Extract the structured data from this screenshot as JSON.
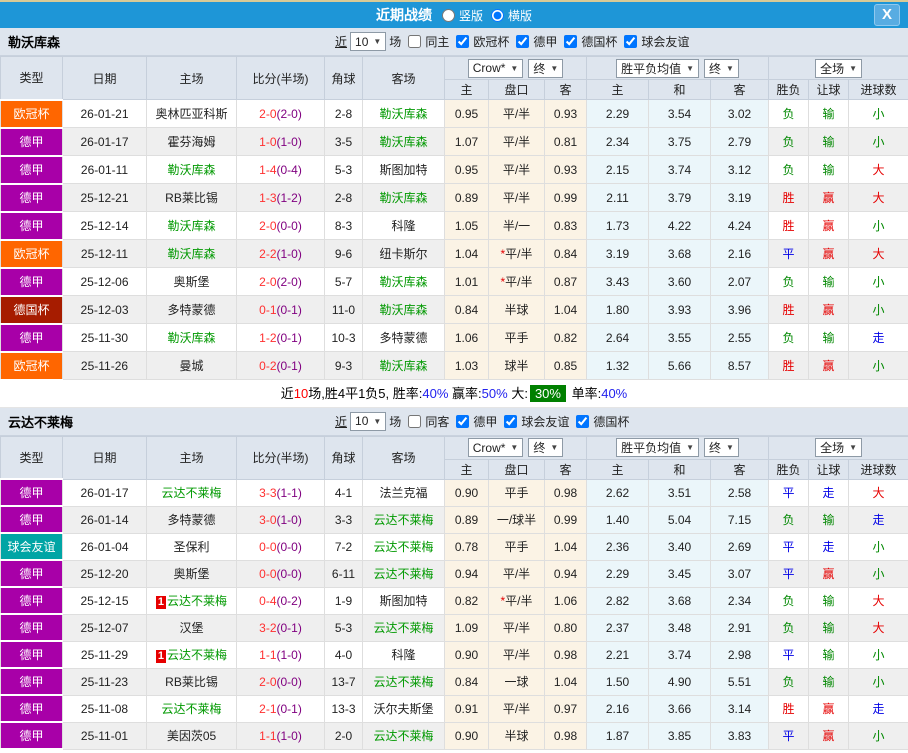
{
  "titlebar": {
    "title": "近期战绩",
    "vertical_label": "竖版",
    "horizontal_label": "横版",
    "horizontal_selected": true,
    "close_label": "X"
  },
  "headers": {
    "type": "类型",
    "date": "日期",
    "home": "主场",
    "score": "比分(半场)",
    "corner": "角球",
    "away": "客场",
    "crow": "Crow*",
    "final1": "终",
    "avg": "胜平负均值",
    "final2": "终",
    "full": "全场",
    "h1": "主",
    "handicap": "盘口",
    "a1": "客",
    "h2": "主",
    "draw": "和",
    "a2": "客",
    "wl": "胜负",
    "let_goal": "让球",
    "goals": "进球数"
  },
  "type_colors": {
    "欧冠杯": "#FF6600",
    "德甲": "#A800A8",
    "德国杯": "#A61C00",
    "球会友谊": "#00A5A5"
  },
  "result_colors": {
    "r": "#E60000",
    "g": "#008800",
    "b": "#0000E6"
  },
  "sections": [
    {
      "team": "勒沃库森",
      "filter": {
        "near_label": "近",
        "count": "10",
        "matches_label": "场",
        "same_label": "同主",
        "same_checked": false,
        "leagues": [
          {
            "label": "欧冠杯",
            "checked": true
          },
          {
            "label": "德甲",
            "checked": true
          },
          {
            "label": "德国杯",
            "checked": true
          },
          {
            "label": "球会友谊",
            "checked": true
          }
        ]
      },
      "rows": [
        {
          "type": "欧冠杯",
          "date": "26-01-21",
          "home": "奥林匹亚科斯",
          "home_hl": false,
          "badge": "",
          "score": "2-0",
          "half": "(2-0)",
          "corner": "2-8",
          "away": "勒沃库森",
          "away_hl": true,
          "o": [
            "0.95",
            "平/半",
            "0.93"
          ],
          "avg": [
            "2.29",
            "3.54",
            "3.02"
          ],
          "res": [
            [
              "负",
              "g"
            ],
            [
              "输",
              "g"
            ],
            [
              "小",
              "g"
            ]
          ]
        },
        {
          "type": "德甲",
          "date": "26-01-17",
          "home": "霍芬海姆",
          "home_hl": false,
          "badge": "",
          "score": "1-0",
          "half": "(1-0)",
          "corner": "3-5",
          "away": "勒沃库森",
          "away_hl": true,
          "o": [
            "1.07",
            "平/半",
            "0.81"
          ],
          "avg": [
            "2.34",
            "3.75",
            "2.79"
          ],
          "res": [
            [
              "负",
              "g"
            ],
            [
              "输",
              "g"
            ],
            [
              "小",
              "g"
            ]
          ]
        },
        {
          "type": "德甲",
          "date": "26-01-11",
          "home": "勒沃库森",
          "home_hl": true,
          "badge": "",
          "score": "1-4",
          "half": "(0-4)",
          "corner": "5-3",
          "away": "斯图加特",
          "away_hl": false,
          "o": [
            "0.95",
            "平/半",
            "0.93"
          ],
          "avg": [
            "2.15",
            "3.74",
            "3.12"
          ],
          "res": [
            [
              "负",
              "g"
            ],
            [
              "输",
              "g"
            ],
            [
              "大",
              "r"
            ]
          ]
        },
        {
          "type": "德甲",
          "date": "25-12-21",
          "home": "RB莱比锡",
          "home_hl": false,
          "badge": "",
          "score": "1-3",
          "half": "(1-2)",
          "corner": "2-8",
          "away": "勒沃库森",
          "away_hl": true,
          "o": [
            "0.89",
            "平/半",
            "0.99"
          ],
          "avg": [
            "2.11",
            "3.79",
            "3.19"
          ],
          "res": [
            [
              "胜",
              "r"
            ],
            [
              "赢",
              "r"
            ],
            [
              "大",
              "r"
            ]
          ]
        },
        {
          "type": "德甲",
          "date": "25-12-14",
          "home": "勒沃库森",
          "home_hl": true,
          "badge": "",
          "score": "2-0",
          "half": "(0-0)",
          "corner": "8-3",
          "away": "科隆",
          "away_hl": false,
          "o": [
            "1.05",
            "半/一",
            "0.83"
          ],
          "avg": [
            "1.73",
            "4.22",
            "4.24"
          ],
          "res": [
            [
              "胜",
              "r"
            ],
            [
              "赢",
              "r"
            ],
            [
              "小",
              "g"
            ]
          ]
        },
        {
          "type": "欧冠杯",
          "date": "25-12-11",
          "home": "勒沃库森",
          "home_hl": true,
          "badge": "",
          "score": "2-2",
          "half": "(1-0)",
          "corner": "9-6",
          "away": "纽卡斯尔",
          "away_hl": false,
          "o": [
            "1.04",
            "*平/半",
            "0.84"
          ],
          "avg": [
            "3.19",
            "3.68",
            "2.16"
          ],
          "res": [
            [
              "平",
              "b"
            ],
            [
              "赢",
              "r"
            ],
            [
              "大",
              "r"
            ]
          ]
        },
        {
          "type": "德甲",
          "date": "25-12-06",
          "home": "奥斯堡",
          "home_hl": false,
          "badge": "",
          "score": "2-0",
          "half": "(2-0)",
          "corner": "5-7",
          "away": "勒沃库森",
          "away_hl": true,
          "o": [
            "1.01",
            "*平/半",
            "0.87"
          ],
          "avg": [
            "3.43",
            "3.60",
            "2.07"
          ],
          "res": [
            [
              "负",
              "g"
            ],
            [
              "输",
              "g"
            ],
            [
              "小",
              "g"
            ]
          ]
        },
        {
          "type": "德国杯",
          "date": "25-12-03",
          "home": "多特蒙德",
          "home_hl": false,
          "badge": "",
          "score": "0-1",
          "half": "(0-1)",
          "corner": "11-0",
          "away": "勒沃库森",
          "away_hl": true,
          "o": [
            "0.84",
            "半球",
            "1.04"
          ],
          "avg": [
            "1.80",
            "3.93",
            "3.96"
          ],
          "res": [
            [
              "胜",
              "r"
            ],
            [
              "赢",
              "r"
            ],
            [
              "小",
              "g"
            ]
          ]
        },
        {
          "type": "德甲",
          "date": "25-11-30",
          "home": "勒沃库森",
          "home_hl": true,
          "badge": "",
          "score": "1-2",
          "half": "(0-1)",
          "corner": "10-3",
          "away": "多特蒙德",
          "away_hl": false,
          "o": [
            "1.06",
            "平手",
            "0.82"
          ],
          "avg": [
            "2.64",
            "3.55",
            "2.55"
          ],
          "res": [
            [
              "负",
              "g"
            ],
            [
              "输",
              "g"
            ],
            [
              "走",
              "b"
            ]
          ]
        },
        {
          "type": "欧冠杯",
          "date": "25-11-26",
          "home": "曼城",
          "home_hl": false,
          "badge": "",
          "score": "0-2",
          "half": "(0-1)",
          "corner": "9-3",
          "away": "勒沃库森",
          "away_hl": true,
          "o": [
            "1.03",
            "球半",
            "0.85"
          ],
          "avg": [
            "1.32",
            "5.66",
            "8.57"
          ],
          "res": [
            [
              "胜",
              "r"
            ],
            [
              "赢",
              "r"
            ],
            [
              "小",
              "g"
            ]
          ]
        }
      ],
      "summary": {
        "pre": "近",
        "count": "10",
        "mid": "场,胜4平1负5, 胜率:",
        "win_rate": "40%",
        "l2": "赢率:",
        "v2": "50%",
        "l3": "大:",
        "v3": "30%",
        "l4": "单率:",
        "v4": "40%"
      }
    },
    {
      "team": "云达不莱梅",
      "filter": {
        "near_label": "近",
        "count": "10",
        "matches_label": "场",
        "same_label": "同客",
        "same_checked": false,
        "leagues": [
          {
            "label": "德甲",
            "checked": true
          },
          {
            "label": "球会友谊",
            "checked": true
          },
          {
            "label": "德国杯",
            "checked": true
          }
        ]
      },
      "rows": [
        {
          "type": "德甲",
          "date": "26-01-17",
          "home": "云达不莱梅",
          "home_hl": true,
          "badge": "",
          "score": "3-3",
          "half": "(1-1)",
          "corner": "4-1",
          "away": "法兰克福",
          "away_hl": false,
          "o": [
            "0.90",
            "平手",
            "0.98"
          ],
          "avg": [
            "2.62",
            "3.51",
            "2.58"
          ],
          "res": [
            [
              "平",
              "b"
            ],
            [
              "走",
              "b"
            ],
            [
              "大",
              "r"
            ]
          ]
        },
        {
          "type": "德甲",
          "date": "26-01-14",
          "home": "多特蒙德",
          "home_hl": false,
          "badge": "",
          "score": "3-0",
          "half": "(1-0)",
          "corner": "3-3",
          "away": "云达不莱梅",
          "away_hl": true,
          "o": [
            "0.89",
            "一/球半",
            "0.99"
          ],
          "avg": [
            "1.40",
            "5.04",
            "7.15"
          ],
          "res": [
            [
              "负",
              "g"
            ],
            [
              "输",
              "g"
            ],
            [
              "走",
              "b"
            ]
          ]
        },
        {
          "type": "球会友谊",
          "date": "26-01-04",
          "home": "圣保利",
          "home_hl": false,
          "badge": "",
          "score": "0-0",
          "half": "(0-0)",
          "corner": "7-2",
          "away": "云达不莱梅",
          "away_hl": true,
          "o": [
            "0.78",
            "平手",
            "1.04"
          ],
          "avg": [
            "2.36",
            "3.40",
            "2.69"
          ],
          "res": [
            [
              "平",
              "b"
            ],
            [
              "走",
              "b"
            ],
            [
              "小",
              "g"
            ]
          ]
        },
        {
          "type": "德甲",
          "date": "25-12-20",
          "home": "奥斯堡",
          "home_hl": false,
          "badge": "",
          "score": "0-0",
          "half": "(0-0)",
          "corner": "6-11",
          "away": "云达不莱梅",
          "away_hl": true,
          "o": [
            "0.94",
            "平/半",
            "0.94"
          ],
          "avg": [
            "2.29",
            "3.45",
            "3.07"
          ],
          "res": [
            [
              "平",
              "b"
            ],
            [
              "赢",
              "r"
            ],
            [
              "小",
              "g"
            ]
          ]
        },
        {
          "type": "德甲",
          "date": "25-12-15",
          "home": "云达不莱梅",
          "home_hl": true,
          "badge": "1",
          "score": "0-4",
          "half": "(0-2)",
          "corner": "1-9",
          "away": "斯图加特",
          "away_hl": false,
          "o": [
            "0.82",
            "*平/半",
            "1.06"
          ],
          "avg": [
            "2.82",
            "3.68",
            "2.34"
          ],
          "res": [
            [
              "负",
              "g"
            ],
            [
              "输",
              "g"
            ],
            [
              "大",
              "r"
            ]
          ]
        },
        {
          "type": "德甲",
          "date": "25-12-07",
          "home": "汉堡",
          "home_hl": false,
          "badge": "",
          "score": "3-2",
          "half": "(0-1)",
          "corner": "5-3",
          "away": "云达不莱梅",
          "away_hl": true,
          "o": [
            "1.09",
            "平/半",
            "0.80"
          ],
          "avg": [
            "2.37",
            "3.48",
            "2.91"
          ],
          "res": [
            [
              "负",
              "g"
            ],
            [
              "输",
              "g"
            ],
            [
              "大",
              "r"
            ]
          ]
        },
        {
          "type": "德甲",
          "date": "25-11-29",
          "home": "云达不莱梅",
          "home_hl": true,
          "badge": "1",
          "score": "1-1",
          "half": "(1-0)",
          "corner": "4-0",
          "away": "科隆",
          "away_hl": false,
          "o": [
            "0.90",
            "平/半",
            "0.98"
          ],
          "avg": [
            "2.21",
            "3.74",
            "2.98"
          ],
          "res": [
            [
              "平",
              "b"
            ],
            [
              "输",
              "g"
            ],
            [
              "小",
              "g"
            ]
          ]
        },
        {
          "type": "德甲",
          "date": "25-11-23",
          "home": "RB莱比锡",
          "home_hl": false,
          "badge": "",
          "score": "2-0",
          "half": "(0-0)",
          "corner": "13-7",
          "away": "云达不莱梅",
          "away_hl": true,
          "o": [
            "0.84",
            "一球",
            "1.04"
          ],
          "avg": [
            "1.50",
            "4.90",
            "5.51"
          ],
          "res": [
            [
              "负",
              "g"
            ],
            [
              "输",
              "g"
            ],
            [
              "小",
              "g"
            ]
          ]
        },
        {
          "type": "德甲",
          "date": "25-11-08",
          "home": "云达不莱梅",
          "home_hl": true,
          "badge": "",
          "score": "2-1",
          "half": "(0-1)",
          "corner": "13-3",
          "away": "沃尔夫斯堡",
          "away_hl": false,
          "o": [
            "0.91",
            "平/半",
            "0.97"
          ],
          "avg": [
            "2.16",
            "3.66",
            "3.14"
          ],
          "res": [
            [
              "胜",
              "r"
            ],
            [
              "赢",
              "r"
            ],
            [
              "走",
              "b"
            ]
          ]
        },
        {
          "type": "德甲",
          "date": "25-11-01",
          "home": "美因茨05",
          "home_hl": false,
          "badge": "",
          "score": "1-1",
          "half": "(1-0)",
          "corner": "2-0",
          "away": "云达不莱梅",
          "away_hl": true,
          "o": [
            "0.90",
            "半球",
            "0.98"
          ],
          "avg": [
            "1.87",
            "3.85",
            "3.83"
          ],
          "res": [
            [
              "平",
              "b"
            ],
            [
              "赢",
              "r"
            ],
            [
              "小",
              "g"
            ]
          ]
        }
      ],
      "summary": null
    }
  ]
}
